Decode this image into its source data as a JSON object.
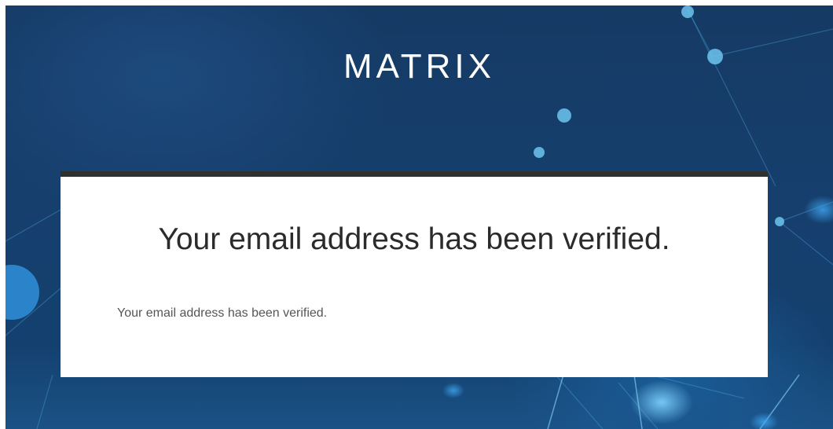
{
  "header": {
    "brand": "MATRIX"
  },
  "card": {
    "title": "Your email address has been verified.",
    "message": "Your email address has been verified."
  },
  "colors": {
    "background": "#163f6d",
    "card_border": "#2f3030",
    "card_background": "#ffffff",
    "brand_text": "#ffffff"
  }
}
